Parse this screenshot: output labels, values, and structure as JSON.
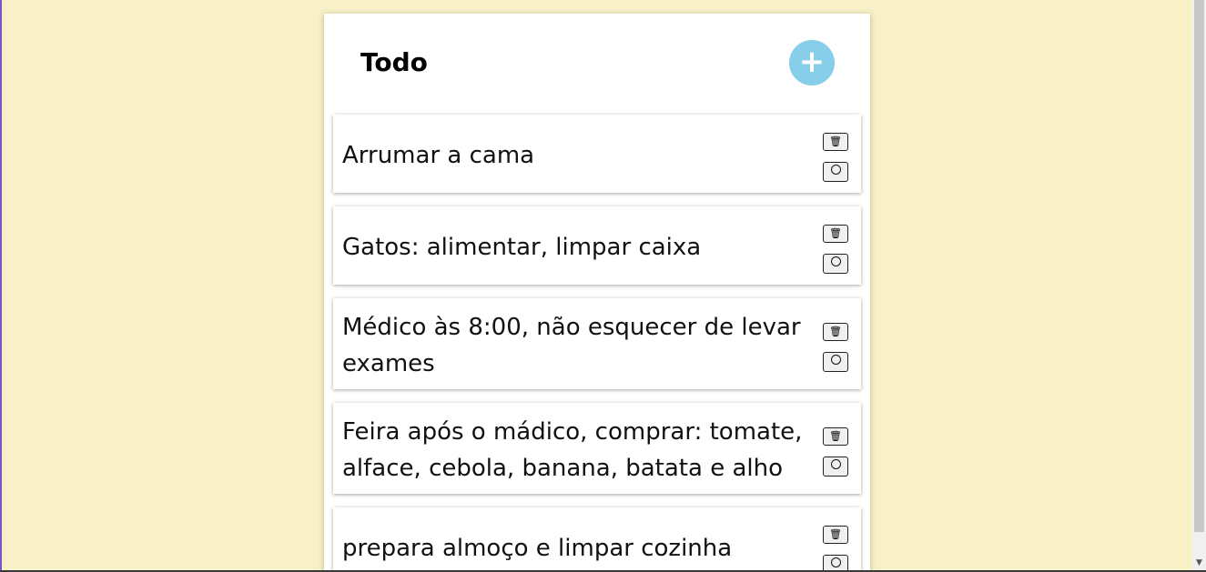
{
  "app": {
    "title": "Todo",
    "add_button_label": "+"
  },
  "todos": [
    {
      "text": "Arrumar a cama",
      "delete_icon": "🗑"
    },
    {
      "text": "Gatos: alimentar, limpar caixa",
      "delete_icon": "🗑"
    },
    {
      "text": "Médico às 8:00, não esquecer de levar exames",
      "delete_icon": "🗑"
    },
    {
      "text": "Feira após o mádico, comprar: tomate, alface, cebola, banana, batata e alho",
      "delete_icon": "🗑"
    },
    {
      "text": "prepara almoço e limpar cozinha",
      "delete_icon": "🗑"
    }
  ],
  "colors": {
    "background": "#f8f0c6",
    "add_button": "#87ceeb",
    "card": "#ffffff"
  },
  "icons": {
    "delete": "trash-icon",
    "complete": "circle-icon"
  }
}
